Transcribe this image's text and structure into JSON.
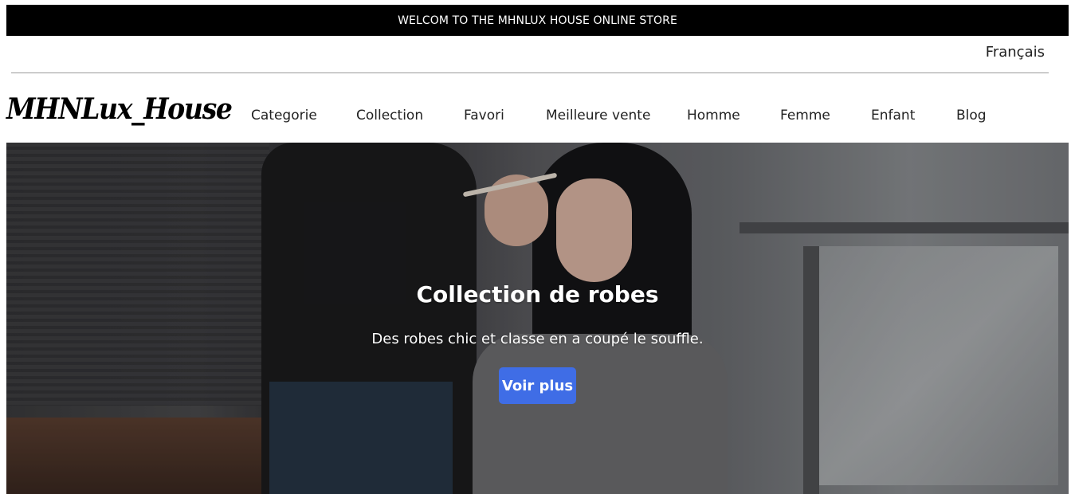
{
  "topbar": {
    "text": "WELCOM TO THE MHNLUX HOUSE ONLINE STORE"
  },
  "language": {
    "label": "Français"
  },
  "logo": {
    "text": "MHNLux_House"
  },
  "nav": {
    "items": [
      {
        "label": "Categorie"
      },
      {
        "label": "Collection"
      },
      {
        "label": "Favori"
      },
      {
        "label": "Meilleure vente"
      },
      {
        "label": "Homme"
      },
      {
        "label": "Femme"
      },
      {
        "label": "Enfant"
      },
      {
        "label": "Blog"
      }
    ]
  },
  "hero": {
    "title": "Collection de robes",
    "subtitle": "Des robes chic et classe en a coupé le souffle.",
    "button_label": "Voir plus",
    "button_color": "#3f6de6"
  }
}
